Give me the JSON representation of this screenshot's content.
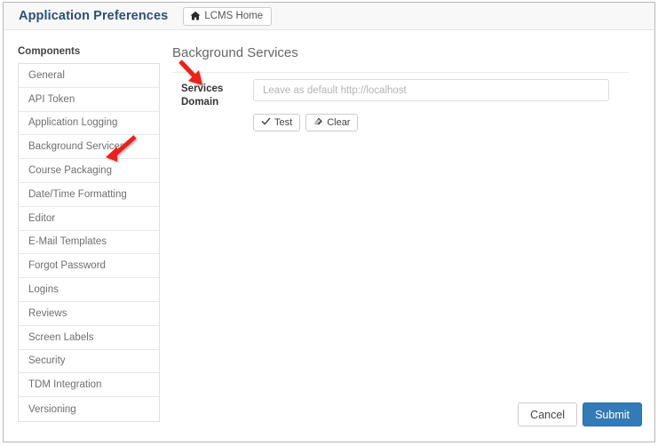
{
  "header": {
    "app_title": "Application Preferences",
    "home_button_label": "LCMS Home",
    "home_icon": "home-icon"
  },
  "sidebar": {
    "heading": "Components",
    "items": [
      {
        "label": "General"
      },
      {
        "label": "API Token"
      },
      {
        "label": "Application Logging"
      },
      {
        "label": "Background Services"
      },
      {
        "label": "Course Packaging"
      },
      {
        "label": "Date/Time Formatting"
      },
      {
        "label": "Editor"
      },
      {
        "label": "E-Mail Templates"
      },
      {
        "label": "Forgot Password"
      },
      {
        "label": "Logins"
      },
      {
        "label": "Reviews"
      },
      {
        "label": "Screen Labels"
      },
      {
        "label": "Security"
      },
      {
        "label": "TDM Integration"
      },
      {
        "label": "Versioning"
      }
    ]
  },
  "main": {
    "panel_title": "Background Services",
    "field_label": "Services Domain",
    "field_value": "",
    "field_placeholder": "Leave as default http://localhost",
    "test_button_label": "Test",
    "test_button_icon": "check-icon",
    "clear_button_label": "Clear",
    "clear_button_icon": "eraser-icon"
  },
  "footer": {
    "cancel_label": "Cancel",
    "submit_label": "Submit"
  },
  "annotations": {
    "arrow_color": "#e8201a",
    "arrow_sidebar_target": "Background Services",
    "arrow_field_target": "Services Domain"
  },
  "colors": {
    "app_title": "#2d4f76",
    "primary_button": "#337ab7",
    "topbar_background": "#f8f8f8",
    "arrow": "#e8201a"
  }
}
